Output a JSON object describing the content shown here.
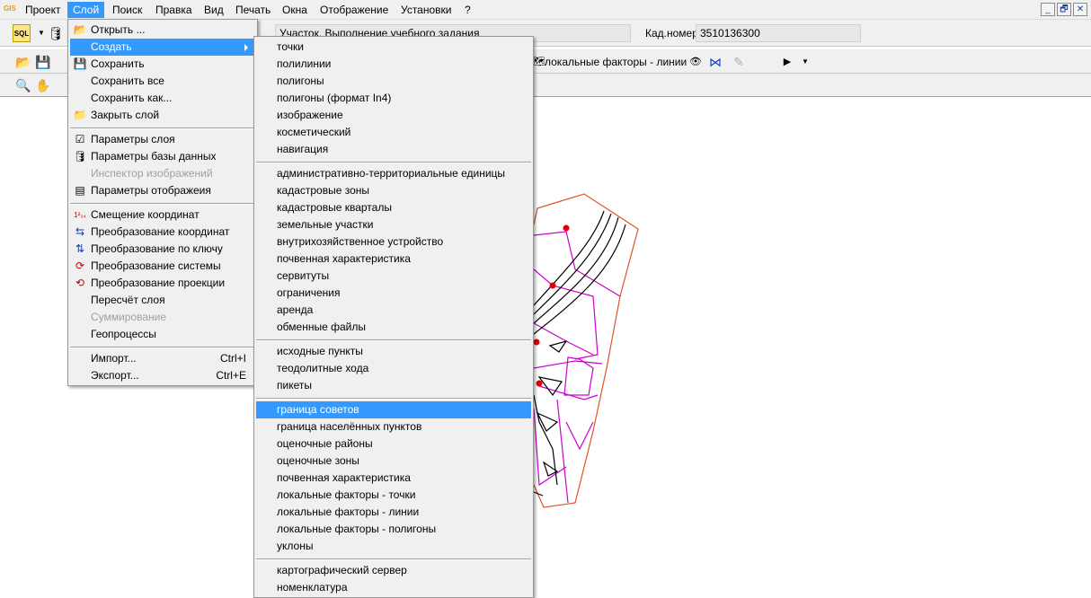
{
  "app_icon": "GIS",
  "menubar": [
    {
      "label": "Проект"
    },
    {
      "label": "Слой"
    },
    {
      "label": "Поиск"
    },
    {
      "label": "Правка"
    },
    {
      "label": "Вид"
    },
    {
      "label": "Печать"
    },
    {
      "label": "Окна"
    },
    {
      "label": "Отображение"
    },
    {
      "label": "Установки"
    },
    {
      "label": "?"
    }
  ],
  "window_controls": {
    "minimize": "_",
    "restore": "🗗",
    "close": "✕"
  },
  "toolbar1": {
    "sql_label": "SQL",
    "parcel_field": "Участок. Выполнение учебного задания",
    "cadastral_label": "Кад.номер",
    "cadastral_value": "3510136300"
  },
  "toolbar2": {
    "active_layer": "локальные факторы - линии"
  },
  "layer_menu": {
    "items": [
      {
        "label": "Открыть ...",
        "icon": "open-icon"
      },
      {
        "label": "Создать",
        "icon": "none"
      },
      {
        "label": "Сохранить",
        "icon": "save-icon"
      },
      {
        "label": "Сохранить все",
        "icon": "none"
      },
      {
        "label": "Сохранить как...",
        "icon": "none"
      },
      {
        "label": "Закрыть слой",
        "icon": "close-layer-icon"
      },
      {
        "label": "Параметры слоя",
        "icon": "layer-params-icon"
      },
      {
        "label": "Параметры базы данных",
        "icon": "database-icon"
      },
      {
        "label": "Инспектор изображений",
        "icon": "none"
      },
      {
        "label": "Параметры отображеия",
        "icon": "display-params-icon"
      },
      {
        "label": "Смещение координат",
        "icon": "offset-icon"
      },
      {
        "label": "Преобразование координат",
        "icon": "transform-icon"
      },
      {
        "label": "Преобразование по ключу",
        "icon": "key-transform-icon"
      },
      {
        "label": "Преобразование системы",
        "icon": "system-transform-icon"
      },
      {
        "label": "Преобразование проекции",
        "icon": "projection-icon"
      },
      {
        "label": "Пересчёт слоя",
        "icon": "none"
      },
      {
        "label": "Суммирование",
        "icon": "none"
      },
      {
        "label": "Геопроцессы",
        "icon": "none"
      },
      {
        "label": "Импорт...",
        "shortcut": "Ctrl+I"
      },
      {
        "label": "Экспорт...",
        "shortcut": "Ctrl+E"
      }
    ]
  },
  "create_menu": {
    "items": [
      {
        "label": "точки"
      },
      {
        "label": "полилинии"
      },
      {
        "label": "полигоны"
      },
      {
        "label": "полигоны (формат In4)"
      },
      {
        "label": "изображение"
      },
      {
        "label": "косметический"
      },
      {
        "label": "навигация"
      },
      {
        "label": "административно-территориальные единицы"
      },
      {
        "label": "кадастровые зоны"
      },
      {
        "label": "кадастровые кварталы"
      },
      {
        "label": "земельные участки"
      },
      {
        "label": "внутрихозяйственное устройство"
      },
      {
        "label": "почвенная характеристика"
      },
      {
        "label": "сервитуты"
      },
      {
        "label": "ограничения"
      },
      {
        "label": "аренда"
      },
      {
        "label": "обменные файлы"
      },
      {
        "label": "исходные пункты"
      },
      {
        "label": "теодолитные хода"
      },
      {
        "label": "пикеты"
      },
      {
        "label": "граница советов"
      },
      {
        "label": "граница населённых пунктов"
      },
      {
        "label": "оценочные районы"
      },
      {
        "label": "оценочные зоны"
      },
      {
        "label": "почвенная характеристика"
      },
      {
        "label": "локальные факторы - точки"
      },
      {
        "label": "локальные факторы - линии"
      },
      {
        "label": "локальные факторы - полигоны"
      },
      {
        "label": "уклоны"
      },
      {
        "label": "картографический сервер"
      },
      {
        "label": "номенклатура"
      }
    ]
  },
  "colors": {
    "highlight": "#3399ff",
    "map_boundary": "#e0522a",
    "map_magenta": "#cc00cc",
    "map_points": "#e00000"
  }
}
